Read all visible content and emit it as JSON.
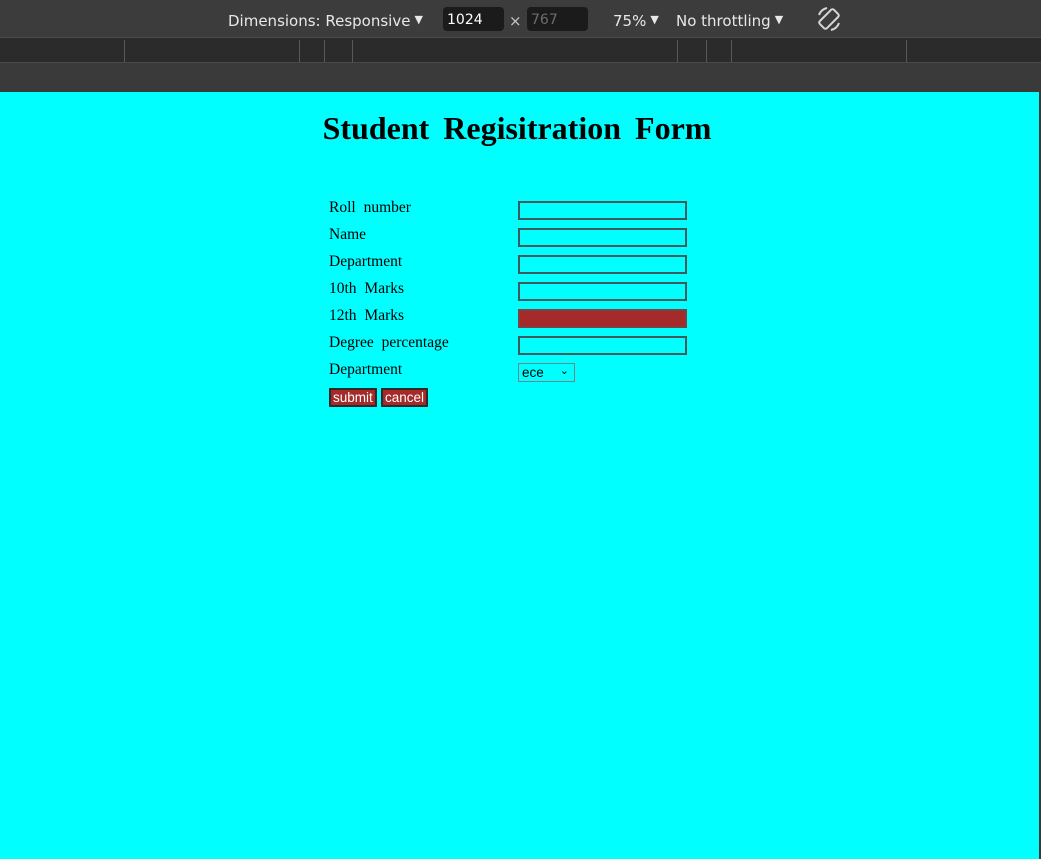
{
  "toolbar": {
    "dimensions_label": "Dimensions: Responsive",
    "width_value": "1024",
    "times": "×",
    "height_value": "767",
    "zoom_label": "75%",
    "throttling_label": "No throttling",
    "rotate_icon": "rotate-icon",
    "dropdown_icon": "triangle-down-icon"
  },
  "page": {
    "title": "Student Regisitration Form",
    "background_color": "#00ffff",
    "accent_color": "#a52a2a"
  },
  "form": {
    "fields": [
      {
        "label": "Roll number",
        "value": ""
      },
      {
        "label": "Name",
        "value": ""
      },
      {
        "label": "Department",
        "value": ""
      },
      {
        "label": "10th Marks",
        "value": ""
      },
      {
        "label": "12th Marks",
        "value": ""
      },
      {
        "label": "Degree percentage",
        "value": ""
      }
    ],
    "department_select": {
      "label": "Department",
      "selected": "ece"
    },
    "submit_label": "submit",
    "cancel_label": "cancel"
  }
}
